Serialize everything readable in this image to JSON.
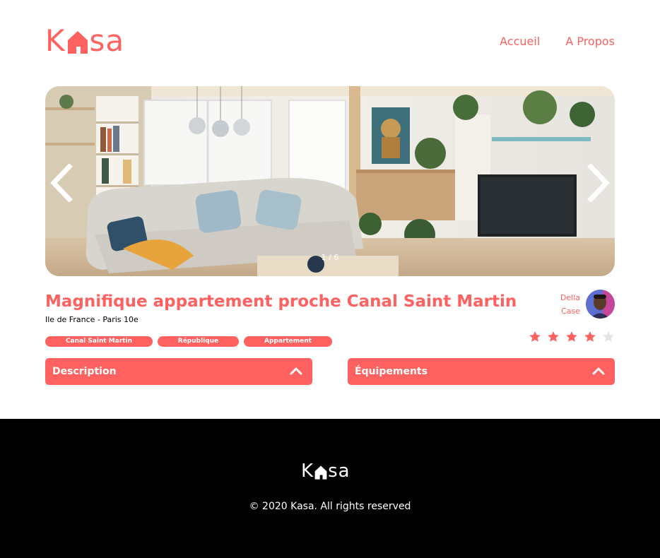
{
  "header": {
    "logo": {
      "left": "K",
      "right": "sa",
      "icon": "house-icon",
      "color": "#FF6060"
    },
    "nav": [
      {
        "label": "Accueil"
      },
      {
        "label": "A Propos"
      }
    ]
  },
  "gallery": {
    "current": 1,
    "total": 6,
    "counter": "1 / 6",
    "prev_icon": "chevron-left-icon",
    "next_icon": "chevron-right-icon"
  },
  "listing": {
    "title": "Magnifique appartement proche Canal Saint Martin",
    "location": "Ile de France - Paris 10e",
    "tags": [
      "Canal Saint Martin",
      "République",
      "Appartement"
    ],
    "rating": 4,
    "rating_max": 5,
    "star_icon": "star-icon"
  },
  "host": {
    "first_name": "Della",
    "last_name": "Case",
    "avatar_icon": "avatar"
  },
  "collapses": {
    "description": {
      "label": "Description",
      "icon": "chevron-up-icon"
    },
    "equipment": {
      "label": "Équipements",
      "icon": "chevron-up-icon"
    }
  },
  "footer": {
    "logo": {
      "left": "K",
      "right": "sa",
      "color": "#FFFFFF"
    },
    "copyright": "© 2020 Kasa. All rights reserved"
  },
  "colors": {
    "accent": "#FF6060",
    "star_active": "#FF6060",
    "star_inactive": "#E3E3E3",
    "footer_bg": "#000000"
  }
}
